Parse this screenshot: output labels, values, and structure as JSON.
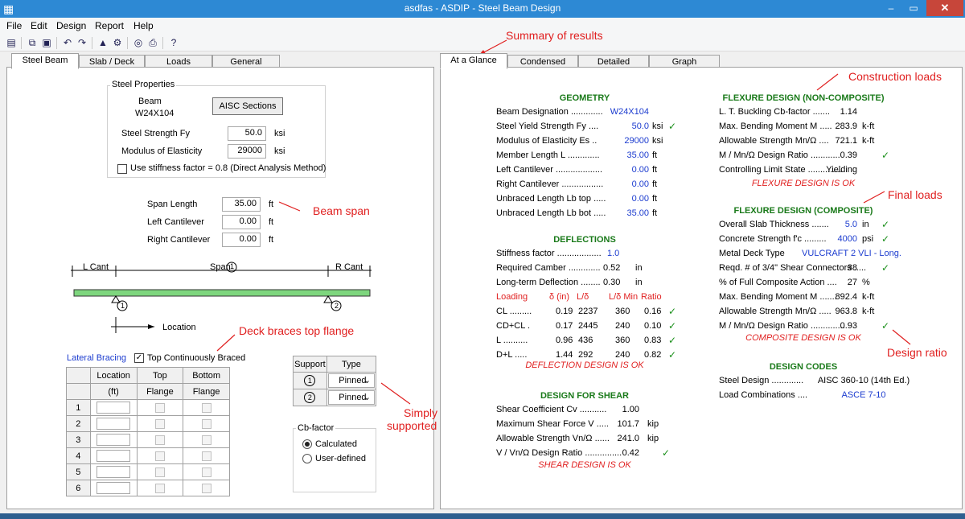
{
  "window": {
    "title": "asdfas - ASDIP - Steel Beam Design",
    "min": "–",
    "max": "▭",
    "close": "✕"
  },
  "menu": [
    "File",
    "Edit",
    "Design",
    "Report",
    "Help"
  ],
  "left_tabs": [
    "Steel Beam",
    "Slab / Deck",
    "Loads",
    "General"
  ],
  "right_tabs": [
    "At a Glance",
    "Condensed",
    "Detailed",
    "Graph"
  ],
  "steel": {
    "group_label": "Steel Properties",
    "beam_label": "Beam",
    "beam_value": "W24X104",
    "aisc_button": "AISC Sections",
    "fy_label": "Steel Strength  Fy",
    "fy_value": "50.0",
    "fy_unit": "ksi",
    "e_label": "Modulus of Elasticity",
    "e_value": "29000",
    "e_unit": "ksi",
    "stiff_label": "Use stiffness factor = 0.8  (Direct Analysis Method)"
  },
  "geometry_inputs": {
    "span_label": "Span Length",
    "span_value": "35.00",
    "span_unit": "ft",
    "lcant_label": "Left Cantilever",
    "lcant_value": "0.00",
    "lcant_unit": "ft",
    "rcant_label": "Right Cantilever",
    "rcant_value": "0.00",
    "rcant_unit": "ft"
  },
  "diagram": {
    "lcant": "L Cant",
    "span": "Span",
    "span_num": "1",
    "rcant": "R Cant",
    "sup1": "1",
    "sup2": "2",
    "location": "Location"
  },
  "bracing": {
    "label": "Lateral Bracing",
    "top_cont": "Top Continuously Braced",
    "headers": [
      "Location",
      "Top",
      "Bottom"
    ],
    "subheaders": [
      "(ft)",
      "Flange",
      "Flange"
    ],
    "rows": [
      "1",
      "2",
      "3",
      "4",
      "5",
      "6"
    ]
  },
  "supports": {
    "headers": [
      "Support",
      "Type"
    ],
    "rows": [
      {
        "id": "1",
        "type": "Pinned"
      },
      {
        "id": "2",
        "type": "Pinned"
      }
    ]
  },
  "cb": {
    "label": "Cb-factor",
    "opt1": "Calculated",
    "opt2": "User-defined"
  },
  "annotations": {
    "summary": "Summary of results",
    "beam_span": "Beam span",
    "deck": "Deck braces top flange",
    "simply1": "Simply",
    "simply2": "supported",
    "construction": "Construction loads",
    "final": "Final loads",
    "design_ratio": "Design ratio"
  },
  "geometry": {
    "title": "GEOMETRY",
    "rows": [
      {
        "label": "Beam Designation  .............",
        "value": "W24X104",
        "unit": "",
        "check": ""
      },
      {
        "label": "Steel Yield Strength  Fy  ....",
        "value": "50.0",
        "unit": "ksi",
        "check": "✓"
      },
      {
        "label": "Modulus of Elasticity  Es  ..",
        "value": "29000",
        "unit": "ksi",
        "check": ""
      },
      {
        "label": "Member Length  L  .............",
        "value": "35.00",
        "unit": "ft",
        "check": ""
      },
      {
        "label": "Left Cantilever  ...................",
        "value": "0.00",
        "unit": "ft",
        "check": ""
      },
      {
        "label": "Right Cantilever  .................",
        "value": "0.00",
        "unit": "ft",
        "check": ""
      },
      {
        "label": "Unbraced Length  Lb top .....",
        "value": "0.00",
        "unit": "ft",
        "check": ""
      },
      {
        "label": "Unbraced Length  Lb bot .....",
        "value": "35.00",
        "unit": "ft",
        "check": ""
      }
    ]
  },
  "deflections": {
    "title": "DEFLECTIONS",
    "stiff_label": "Stiffness factor  ..................",
    "stiff_value": "1.0",
    "camber_label": "Required Camber  .............",
    "camber_value": "0.52",
    "camber_unit": "in",
    "lt_label": "Long-term Deflection  ........",
    "lt_value": "0.30",
    "lt_unit": "in",
    "headers": [
      "Loading",
      "δ (in)",
      "L/δ",
      "L/δ Min",
      "Ratio"
    ],
    "rows": [
      {
        "load": "CL  .........",
        "d": "0.19",
        "ld": "2237",
        "min": "360",
        "ratio": "0.16",
        "check": "✓"
      },
      {
        "load": "CD+CL  .",
        "d": "0.17",
        "ld": "2445",
        "min": "240",
        "ratio": "0.10",
        "check": "✓"
      },
      {
        "load": "L  ..........",
        "d": "0.96",
        "ld": "436",
        "min": "360",
        "ratio": "0.83",
        "check": "✓"
      },
      {
        "load": "D+L  .....",
        "d": "1.44",
        "ld": "292",
        "min": "240",
        "ratio": "0.82",
        "check": "✓"
      }
    ],
    "ok": "DEFLECTION DESIGN IS OK"
  },
  "shear": {
    "title": "DESIGN FOR SHEAR",
    "rows": [
      {
        "label": "Shear Coefficient  Cv  ...........",
        "value": "1.00",
        "unit": "",
        "check": ""
      },
      {
        "label": "Maximum Shear Force  V  .....",
        "value": "101.7",
        "unit": "kip",
        "check": ""
      },
      {
        "label": "Allowable Strength  Vn/Ω  ......",
        "value": "241.0",
        "unit": "kip",
        "check": ""
      },
      {
        "label": "V / Vn/Ω Design Ratio  ...............",
        "value": "0.42",
        "unit": "",
        "check": "✓"
      }
    ],
    "ok": "SHEAR DESIGN IS OK"
  },
  "flex_nc": {
    "title": "FLEXURE DESIGN (NON-COMPOSITE)",
    "rows": [
      {
        "label": "L. T. Buckling Cb-factor  .......",
        "value": "1.14",
        "unit": "",
        "check": ""
      },
      {
        "label": "Max. Bending Moment  M  .....",
        "value": "283.9",
        "unit": "k-ft",
        "check": ""
      },
      {
        "label": "Allowable Strength  Mn/Ω  ....",
        "value": "721.1",
        "unit": "k-ft",
        "check": ""
      },
      {
        "label": "M / Mn/Ω Design Ratio  ............",
        "value": "0.39",
        "unit": "",
        "check": "✓"
      },
      {
        "label": "Controlling Limit State  ..............",
        "value": "Yielding",
        "unit": "",
        "check": ""
      }
    ],
    "ok": "FLEXURE DESIGN IS OK"
  },
  "flex_c": {
    "title": "FLEXURE DESIGN (COMPOSITE)",
    "rows": [
      {
        "label": "Overall Slab Thickness  .......",
        "value": "5.0",
        "unit": "in",
        "check": "✓"
      },
      {
        "label": "Concrete Strength  f'c  .........",
        "value": "4000",
        "unit": "psi",
        "check": "✓"
      },
      {
        "label": "Metal Deck Type",
        "value": "VULCRAFT 2 VLI - Long.",
        "unit": "",
        "check": ""
      },
      {
        "label": "Reqd. # of 3/4\" Shear Connectors  .....",
        "value": "38",
        "unit": "",
        "check": "✓"
      },
      {
        "label": "% of Full Composite Action  ....",
        "value": "27",
        "unit": "%",
        "check": ""
      },
      {
        "label": "Max. Bending Moment  M  .......",
        "value": "892.4",
        "unit": "k-ft",
        "check": ""
      },
      {
        "label": "Allowable Strength  Mn/Ω  .....",
        "value": "963.8",
        "unit": "k-ft",
        "check": ""
      },
      {
        "label": "M / Mn/Ω Design Ratio  ..............",
        "value": "0.93",
        "unit": "",
        "check": "✓"
      }
    ],
    "ok": "COMPOSITE DESIGN IS OK"
  },
  "codes": {
    "title": "DESIGN CODES",
    "rows": [
      {
        "label": "Steel Design  .............",
        "value": "AISC 360-10 (14th Ed.)"
      },
      {
        "label": "Load Combinations  ....",
        "value": "ASCE 7-10"
      }
    ]
  }
}
